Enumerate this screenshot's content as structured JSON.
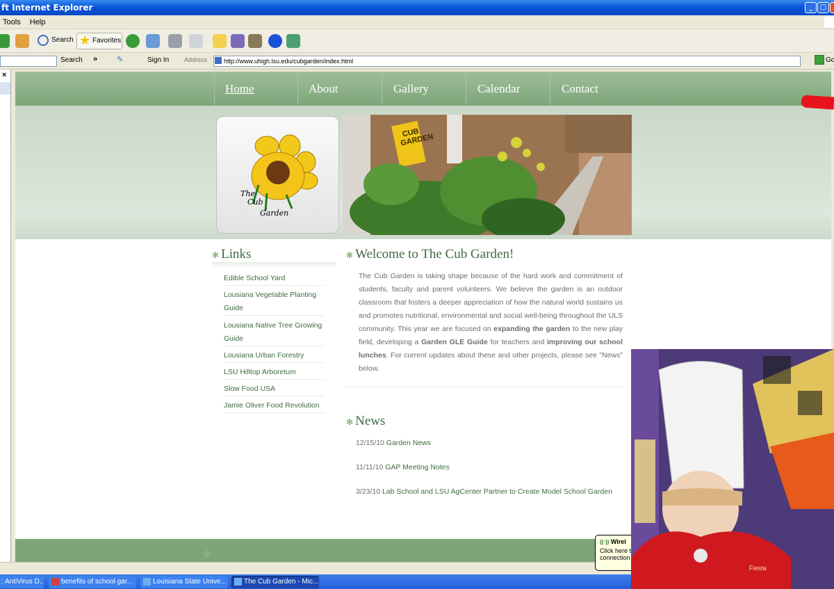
{
  "window": {
    "title": "ft Internet Explorer"
  },
  "menu": [
    "Tools",
    "Help"
  ],
  "toolbar": {
    "search_label": "Search",
    "favorites_label": "Favorites"
  },
  "linksbar": {
    "search_label": "Search",
    "sign_in_label": "Sign In"
  },
  "address": {
    "label": "Address",
    "url": "http://www.uhigh.lsu.edu/cubgarden/index.html",
    "go_label": "Go"
  },
  "site": {
    "nav": [
      "Home",
      "About",
      "Gallery",
      "Calendar",
      "Contact"
    ],
    "logo_text": [
      "The",
      "Cub",
      "Garden"
    ],
    "sign_text": "CUB GARDEN",
    "links_heading": "Links",
    "links": [
      "Edible School Yard",
      "Lousiana Vegetable Planting Guide",
      "Lousiana Native Tree Growing Guide",
      "Lousiana Urban Forestry",
      "LSU Hilltop Arboretum",
      "Slow Food USA",
      "Jamie Oliver Food Revolution"
    ],
    "welcome_heading": "Welcome to The Cub Garden!",
    "welcome_text": {
      "p1": "The Cub Garden is taking shape because of the hard work and commitment of students, faculty and parent volunteers.  We believe the garden is an outdoor classroom that fosters a deeper appreciation of how the natural world sustains us and promotes nutritional, environmental and social well-being throughout the ULS community. This year we are focused on ",
      "b1": "expanding the garden",
      "p2": " to the new play field, developing a ",
      "b2": "Garden GLE Guide",
      "p3": " for teachers and ",
      "b3": "improving our school lunches",
      "p4": ".  For current updates about these and other projects, please see \"News\" below."
    },
    "news_heading": "News",
    "news": [
      {
        "date": "12/15/10",
        "title": "Garden News"
      },
      {
        "date": "11/11/10",
        "title": "GAP Meeting Notes"
      },
      {
        "date": "3/23/10",
        "title": "Lab School and LSU AgCenter Partner to Create Model School Garden"
      }
    ]
  },
  "balloon": {
    "title": "Wirel",
    "text": "Click here t connection"
  },
  "badge": {
    "text": "Fiesta"
  },
  "taskbar": [
    "AntiVirus D...",
    "benefits of school gar...",
    "Louisiana State Unive...",
    "The Cub Garden - Mic..."
  ],
  "taskbar_prefix": ":"
}
